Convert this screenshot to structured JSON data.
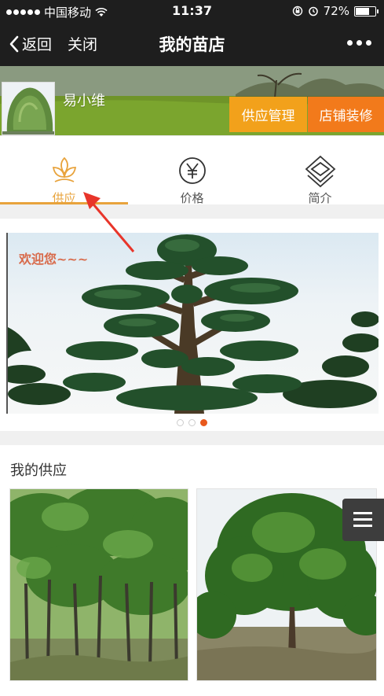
{
  "status_bar": {
    "carrier": "中国移动",
    "time": "11:37",
    "battery": "72%",
    "battery_level": 0.72
  },
  "nav": {
    "back_label": "返回",
    "close_label": "关闭",
    "title": "我的苗店"
  },
  "shop": {
    "username": "易小维",
    "supply_manage_label": "供应管理",
    "shop_decor_label": "店铺装修",
    "accent_colors": {
      "supply": "#f2a11b",
      "decor": "#f27a1b"
    }
  },
  "tabs": [
    {
      "label": "供应",
      "icon": "leaf-icon",
      "active": true
    },
    {
      "label": "价格",
      "icon": "yen-icon",
      "active": false
    },
    {
      "label": "简介",
      "icon": "layers-icon",
      "active": false
    }
  ],
  "carousel": {
    "welcome_text": "欢迎您~~~",
    "slide_count": 3,
    "active_index": 2
  },
  "supply_section": {
    "title": "我的供应"
  },
  "colors": {
    "active_tab": "#e8a33c",
    "pager_active": "#e8581c",
    "bar": "#1e1e1e"
  }
}
